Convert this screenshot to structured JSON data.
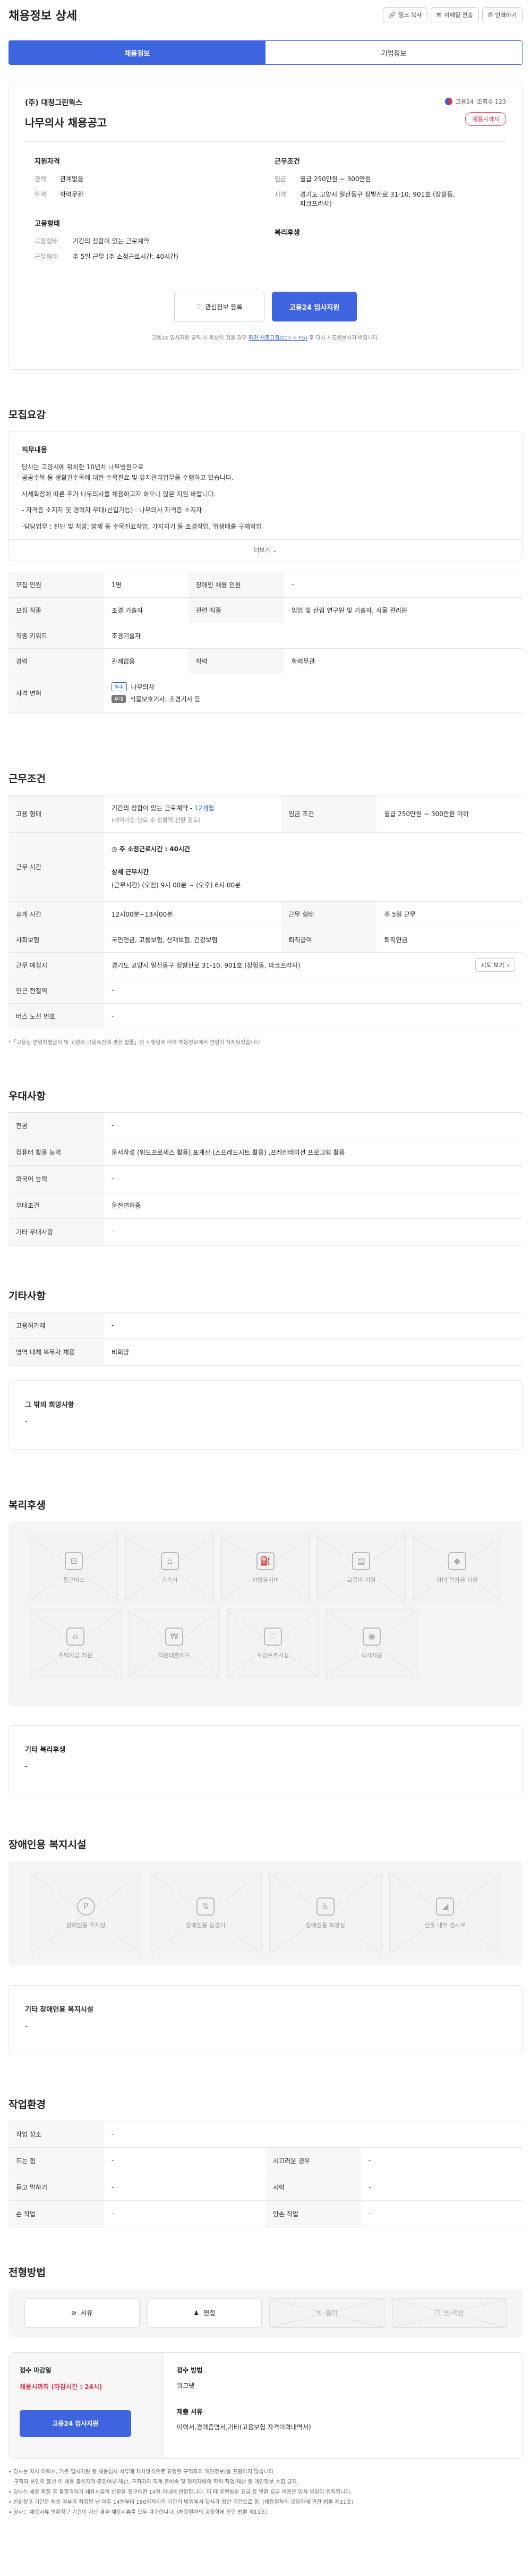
{
  "page": {
    "title": "채용정보 상세",
    "header_buttons": [
      "링크 복사",
      "이메일 전송",
      "인쇄하기"
    ]
  },
  "tabs": [
    {
      "label": "채용정보",
      "active": true
    },
    {
      "label": "기업정보",
      "active": false
    }
  ],
  "company": {
    "name": "(주) 대청그린웍스",
    "title": "나무의사 채용공고",
    "badge": "채용시까지",
    "source": "고용24",
    "views": "조회수 123"
  },
  "summary": {
    "left_heading_1": "지원자격",
    "career_label": "경력",
    "career_value": "관계없음",
    "edu_label": "학력",
    "edu_value": "학력무관",
    "left_heading_2": "고용형태",
    "emp_label": "고용형태",
    "emp_value": "기간의 정함이 있는 근로계약",
    "work_label": "근무형태",
    "work_value": "주 5일 근무 (주 소정근로시간: 40시간)",
    "right_heading_1": "근무조건",
    "wage_label": "임금",
    "wage_value": "월급 250만원 ~ 300만원",
    "area_label": "지역",
    "area_value_1": "경기도 고양시 일산동구 정발산로 31-10, 901호 (장항동,",
    "area_value_2": "파크프라자)",
    "right_heading_2": "복리후생",
    "interest_button": "관심정보 등록",
    "apply_button": "고용24 입사지원",
    "note_1": "고용24 입사지원 클릭 시 화상이 검을 경우 ",
    "note_link": "화면 새로고침(Ctrl + F5)",
    "note_2": " 후 다시 시도해보시기 바랍니다."
  },
  "recruit": {
    "heading": "모집요강",
    "duty_heading": "직무내용",
    "duty_lines": [
      "당사는 고양시에 위치한 10년차 나무병원으로",
      "공공수목 등 생활권수목에 대한 수목진료 및 유지관리업무를 수행하고 있습니다.",
      "",
      "사세확장에 따른 추가 나무의사를 채용하고자 하오니 많은 지원 바랍니다.",
      "",
      "- 자격증 소지자 및 경력자 우대(신입가능) : 나무의사 자격증 소지자",
      "",
      "-담당업무 : 진단 및 처방, 방제 등 수목진료작업, 가지치기 등 조경작업, 위생매출 구제작업"
    ],
    "more": "더보기",
    "rows": [
      {
        "k1": "모집 인원",
        "v1": "1명",
        "k2": "장애인 채용 인원",
        "v2": "-"
      },
      {
        "k1": "모집 직종",
        "v1": "조경 기술자",
        "k2": "관련 직종",
        "v2": "임업 및 산림 연구원 및 기술자, 식물 관리원"
      },
      {
        "k1": "직종 키워드",
        "v1": "조경기술자",
        "k2": "",
        "v2": ""
      },
      {
        "k1": "경력",
        "v1": "관계없음",
        "k2": "학력",
        "v2": "학력무관"
      }
    ],
    "license_label": "자격 면허",
    "licenses": [
      {
        "tag": "필수",
        "name": "나무의사"
      },
      {
        "tag": "우대",
        "name": "식물보호기사, 조경기사 등"
      }
    ]
  },
  "conditions": {
    "heading": "근무조건",
    "emp_type_label": "고용 형태",
    "emp_type_value": "기간의 정함이 있는 근로계약 - ",
    "emp_type_months": "12개월",
    "emp_type_sub": "(계약기간 만료 후 상황적 전환 검토)",
    "wage_label": "임금 조건",
    "wage_value": "월급 250만원 ~ 300만원 이하",
    "hours_label": "근무 시간",
    "hours_week": "주 소정근로시간 : ",
    "hours_week_val": "40시간",
    "hours_detail_title": "상세 근무시간",
    "hours_detail": "(근무시간) (오전) 9시 00분 ~ (오후) 6시 00분",
    "rest_label": "휴게 시간",
    "rest_value": "12시00분~13시00분",
    "form_label": "근무 형태",
    "form_value": "주 5일 근무",
    "insurance_label": "사회보험",
    "insurance_value": "국민연금, 고용보험, 산재보험, 건강보험",
    "retire_label": "퇴직급여",
    "retire_value": "퇴직연금",
    "place_label": "근무 예정지",
    "place_value": "경기도 고양시 일산동구 정발산로 31-10, 901호 (장항동, 파크프라자)",
    "map_button": "지도 보기",
    "station_label": "인근 전철역",
    "station_value": "-",
    "bus_label": "버스 노선 번호",
    "bus_value": "-",
    "footnote": "*「고용상 연령차별금지 및 고령자 고용촉진에 관한 법률」의 시행령에 따라 채용정보에서 연령이 삭제되었습니다."
  },
  "preference": {
    "heading": "우대사항",
    "rows": [
      {
        "k": "전공",
        "v": "-"
      },
      {
        "k": "컴퓨터 활용 능력",
        "v": "문서작성 (워드프로세스 활용),표계산 (스프레드시트 활용) ,프레젠테이션 프로그램 활용"
      },
      {
        "k": "외국어 능력",
        "v": "-"
      },
      {
        "k": "우대조건",
        "v": "운전면허증"
      },
      {
        "k": "기타 우대사항",
        "v": "-"
      }
    ]
  },
  "etc": {
    "heading": "기타사항",
    "rows": [
      {
        "k": "고용허가제",
        "v": "-"
      },
      {
        "k": "병역 대체 복무자 채용",
        "v": "비희망"
      }
    ],
    "other_title": "그 밖의 희망사항",
    "other_value": "-"
  },
  "welfare": {
    "heading": "복리후생",
    "tiles": [
      {
        "label": "통근버스",
        "icon": "bus-icon"
      },
      {
        "label": "기숙사",
        "icon": "dormitory-icon"
      },
      {
        "label": "차량유지비",
        "icon": "car-fuel-icon"
      },
      {
        "label": "교육비 지원",
        "icon": "book-icon"
      },
      {
        "label": "자녀 학자금 지원",
        "icon": "graduation-icon"
      },
      {
        "label": "주택자금 지원",
        "icon": "house-icon"
      },
      {
        "label": "직원대출제도",
        "icon": "loan-icon"
      },
      {
        "label": "모성보호시설",
        "icon": "maternity-icon"
      },
      {
        "label": "식사제공",
        "icon": "meal-icon"
      }
    ],
    "other_title": "기타 복리후생",
    "other_value": "-"
  },
  "disabled": {
    "heading": "장애인용 복지시설",
    "tiles": [
      {
        "label": "장애인용 주차장",
        "icon": "parking-icon"
      },
      {
        "label": "장애인용 승강기",
        "icon": "elevator-icon"
      },
      {
        "label": "장애인용 화장실",
        "icon": "restroom-icon"
      },
      {
        "label": "건물 내부 경사로",
        "icon": "ramp-icon"
      }
    ],
    "other_title": "기타 장애인용 복지시설",
    "other_value": "-"
  },
  "environment": {
    "heading": "작업환경",
    "rows": [
      {
        "k1": "작업 장소",
        "v1": "-",
        "k2": "",
        "v2": ""
      },
      {
        "k1": "드는 힘",
        "v1": "-",
        "k2": "시끄러운 경우",
        "v2": "-"
      },
      {
        "k1": "듣고 말하기",
        "v1": "-",
        "k2": "시력",
        "v2": "-"
      },
      {
        "k1": "손 작업",
        "v1": "-",
        "k2": "양손 작업",
        "v2": "-"
      }
    ]
  },
  "process": {
    "heading": "전형방법",
    "steps": [
      {
        "label": "서류",
        "icon": "check-circle-icon",
        "enabled": true
      },
      {
        "label": "면접",
        "icon": "interview-icon",
        "enabled": true
      },
      {
        "label": "필기",
        "icon": "pencil-icon",
        "enabled": false
      },
      {
        "label": "인·적성",
        "icon": "test-icon",
        "enabled": false
      }
    ],
    "deadline_label": "접수 마감일",
    "deadline_value": "채용시까지 (마감시간 : 24시)",
    "apply_button": "고용24 입사지원",
    "method_label": "접수 방법",
    "method_value": "워크넷",
    "docs_label": "제출 서류",
    "docs_value": "이력서,경력증명서,기타(고용보험 자격이력내역서)",
    "notes": [
      "당사는 자사 이력서, 기존 입사지원 등 채용심사 서류에 자사양식으로 요청한 구직자의 개인정보(를 포함하지 않습니다. ",
      "구직자 본인의 불신 이 채용 출신지역·혼인여부·재산, 구직자의 직계 존비속 및 형제자매의 학력·직업·재산 등 개인정보 수집 금지.",
      "당사는 채용 확정 후 불합격자가 채용서류의 반환을 청구하면 14일 이내에 반환합니다. 이 때 우편발송 요금 등 반환 요금 비용은 당사 부담이 원칙합니다.",
      "반환청구 기간은 채용 여부가 확정된 날 이후 14일부터 180일까지의 기간의 범위에서 당사가 정한 기간으로 함. (채용절차의 공정화에 관한 법률 제11조)",
      "당사는 채용서류 반환청구 기간이 지난 경우 채용서류를 모두 파기합니다. (채용절차의 공정화에 관한 법률 제11조)"
    ]
  },
  "colors": {
    "accent": "#3f64e0",
    "badge": "#e5364e",
    "link": "#2b5fd9"
  }
}
